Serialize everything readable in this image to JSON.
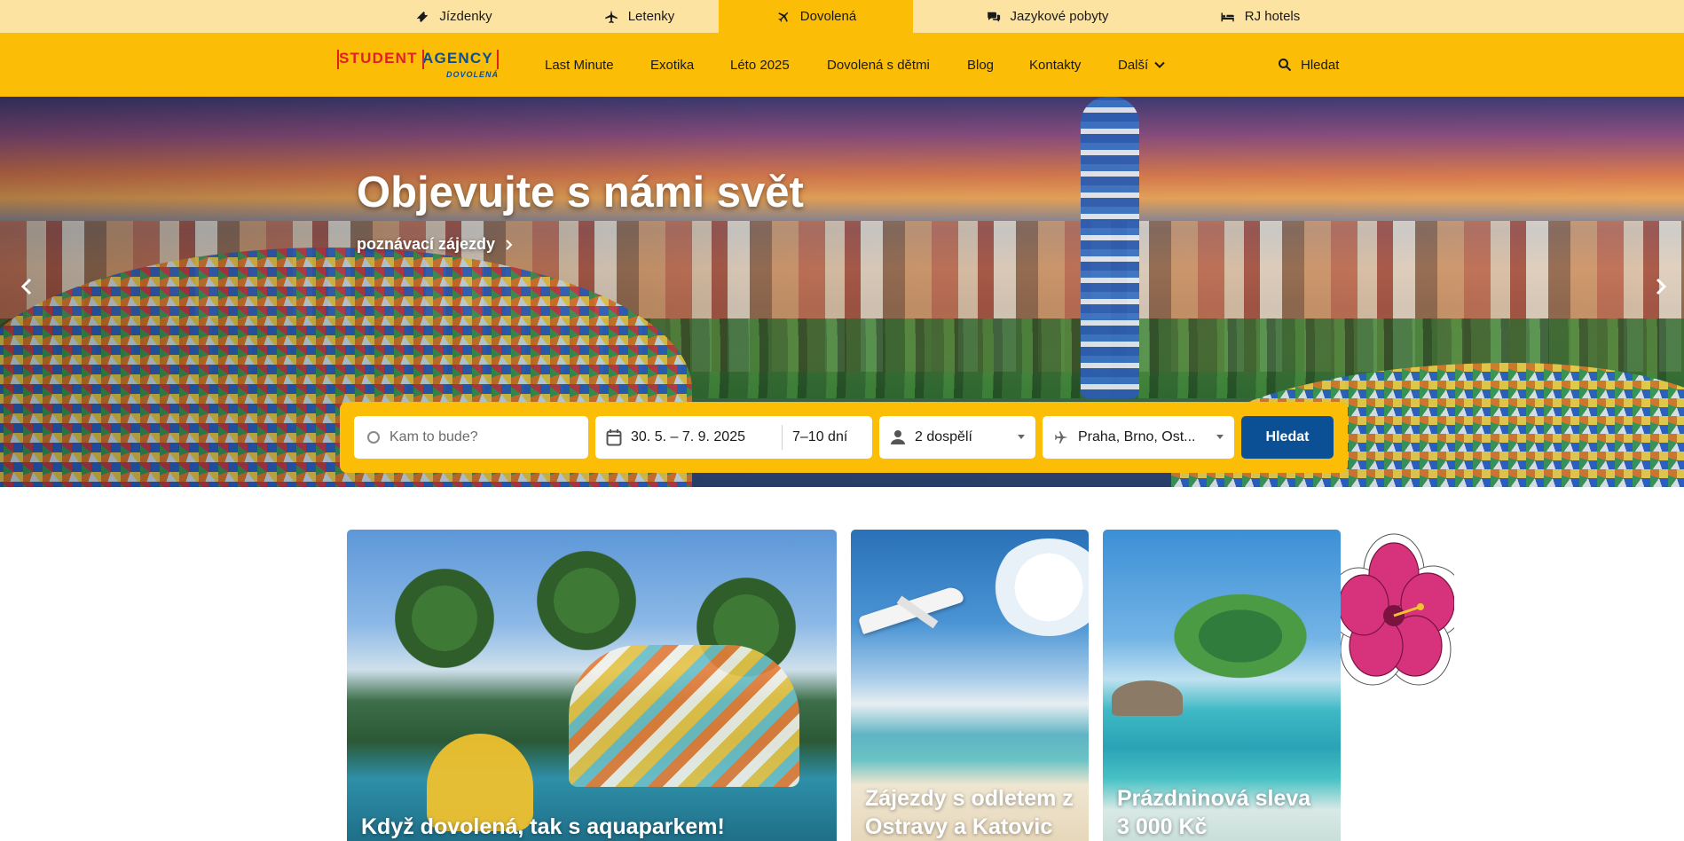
{
  "top_tabs": [
    {
      "label": "Jízdenky",
      "icon": "ticket-icon",
      "active": false
    },
    {
      "label": "Letenky",
      "icon": "airplane-icon",
      "active": false
    },
    {
      "label": "Dovolená",
      "icon": "beach-plane-icon",
      "active": true
    },
    {
      "label": "Jazykové pobyty",
      "icon": "chat-bubbles-icon",
      "active": false
    },
    {
      "label": "RJ hotels",
      "icon": "bed-icon",
      "active": false
    }
  ],
  "logo": {
    "line1_a": "STUDENT",
    "line1_b": "AGENCY",
    "line2": "DOVOLENÁ"
  },
  "nav": {
    "items": [
      "Last Minute",
      "Exotika",
      "Léto 2025",
      "Dovolená s dětmi",
      "Blog",
      "Kontakty",
      "Další"
    ],
    "search_label": "Hledat"
  },
  "hero": {
    "title": "Objevujte s námi svět",
    "subtitle": "poznávací zájezdy"
  },
  "search": {
    "destination_placeholder": "Kam to bude?",
    "dates": "30. 5. – 7. 9. 2025",
    "duration": "7–10 dní",
    "travelers": "2 dospělí",
    "departure": "Praha, Brno, Ost...",
    "button": "Hledat"
  },
  "cards": [
    {
      "caption": "Když dovolená, tak s aquaparkem!"
    },
    {
      "caption_line1": "Zájezdy s odletem z",
      "caption_line2": "Ostravy a Katovic"
    },
    {
      "caption_line1": "Prázdninová sleva",
      "caption_line2": "3 000 Kč"
    }
  ],
  "colors": {
    "brand_yellow": "#fbbd06",
    "top_bar": "#fde3a1",
    "brand_blue": "#0b4f95",
    "brand_red": "#e21f26"
  }
}
